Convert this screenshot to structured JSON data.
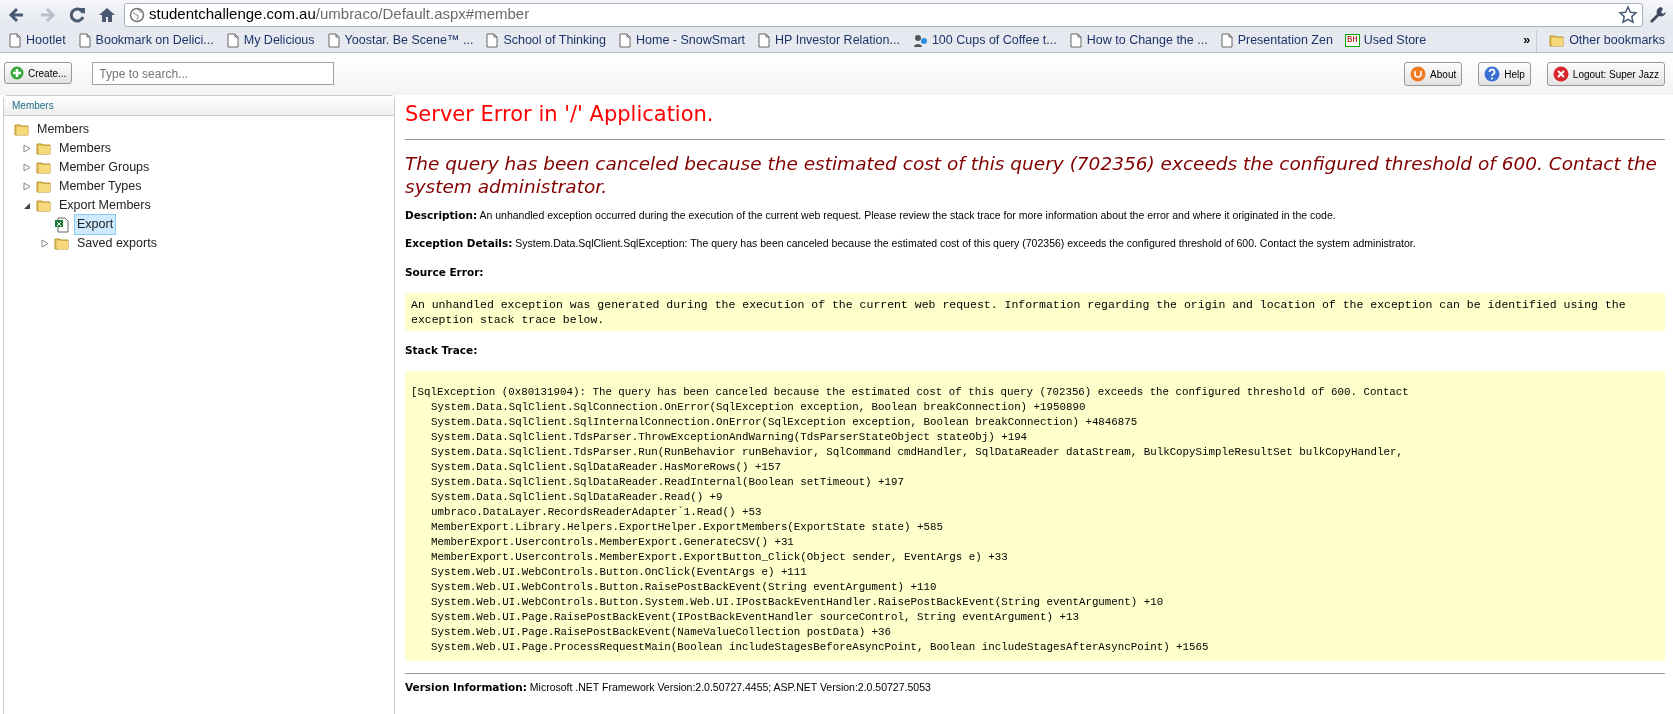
{
  "browser": {
    "nav": [
      {
        "kind": "back",
        "disabled": false
      },
      {
        "kind": "forward",
        "disabled": true
      },
      {
        "kind": "reload",
        "disabled": false
      },
      {
        "kind": "home",
        "disabled": false
      }
    ],
    "address": {
      "host": "studentchallenge.com.au",
      "path": "/umbraco/Default.aspx#member"
    },
    "bookmarks": [
      {
        "label": "Hootlet",
        "kind": "page"
      },
      {
        "label": "Bookmark on Delici...",
        "kind": "page"
      },
      {
        "label": "My Delicious",
        "kind": "page"
      },
      {
        "label": "Yoostar. Be Scene™ ...",
        "kind": "page"
      },
      {
        "label": "School of Thinking",
        "kind": "page"
      },
      {
        "label": "Home - SnowSmart",
        "kind": "page"
      },
      {
        "label": "HP Investor Relation...",
        "kind": "page"
      },
      {
        "label": "100 Cups of Coffee t...",
        "kind": "figure"
      },
      {
        "label": "How to Change the ...",
        "kind": "page"
      },
      {
        "label": "Presentation Zen",
        "kind": "page"
      },
      {
        "label": "Used Store",
        "kind": "letters",
        "icon_text": "BH"
      }
    ],
    "overflow": "»",
    "other_bookmarks": "Other bookmarks"
  },
  "toolbar": {
    "create": "Create...",
    "search": {
      "placeholder": "Type to search..."
    },
    "buttons": [
      {
        "kind": "about",
        "label": "About"
      },
      {
        "kind": "help",
        "label": "Help"
      },
      {
        "kind": "logout",
        "label": "Logout: Super Jazz"
      }
    ]
  },
  "tree": {
    "header": "Members",
    "root": {
      "label": "Members",
      "kind": "folder",
      "selected": false,
      "children": [
        {
          "label": "Members",
          "kind": "folder",
          "expanded": false,
          "selected": false
        },
        {
          "label": "Member Groups",
          "kind": "folder",
          "expanded": false,
          "selected": false
        },
        {
          "label": "Member Types",
          "kind": "folder",
          "expanded": false,
          "selected": false
        },
        {
          "label": "Export Members",
          "kind": "folder",
          "expanded": true,
          "selected": false,
          "children": [
            {
              "label": "Export",
              "kind": "spreadsheet",
              "selected": true
            },
            {
              "label": "Saved exports",
              "kind": "folder",
              "expanded": false,
              "selected": false
            }
          ]
        }
      ]
    }
  },
  "error": {
    "title": "Server Error in '/' Application.",
    "message": "The query has been canceled because the estimated cost of this query (702356) exceeds the configured threshold of 600. Contact the system administrator.",
    "description": {
      "label": "Description:",
      "text": "An unhandled exception occurred during the execution of the current web request. Please review the stack trace for more information about the error and where it originated in the code."
    },
    "exception_details": {
      "label": "Exception Details:",
      "text": "System.Data.SqlClient.SqlException: The query has been canceled because the estimated cost of this query (702356) exceeds the configured threshold of 600. Contact the system administrator."
    },
    "source_error": {
      "label": "Source Error:",
      "text": "An unhandled exception was generated during the execution of the current web request. Information regarding the origin and location of the exception can be identified using the exception stack trace below."
    },
    "stack_trace": {
      "label": "Stack Trace:",
      "exception": "[SqlException (0x80131904): The query has been canceled because the estimated cost of this query (702356) exceeds the configured threshold of 600. Contact",
      "frames": [
        "System.Data.SqlClient.SqlConnection.OnError(SqlException exception, Boolean breakConnection) +1950890",
        "System.Data.SqlClient.SqlInternalConnection.OnError(SqlException exception, Boolean breakConnection) +4846875",
        "System.Data.SqlClient.TdsParser.ThrowExceptionAndWarning(TdsParserStateObject stateObj) +194",
        "System.Data.SqlClient.TdsParser.Run(RunBehavior runBehavior, SqlCommand cmdHandler, SqlDataReader dataStream, BulkCopySimpleResultSet bulkCopyHandler,",
        "System.Data.SqlClient.SqlDataReader.HasMoreRows() +157",
        "System.Data.SqlClient.SqlDataReader.ReadInternal(Boolean setTimeout) +197",
        "System.Data.SqlClient.SqlDataReader.Read() +9",
        "umbraco.DataLayer.RecordsReaderAdapter`1.Read() +53",
        "MemberExport.Library.Helpers.ExportHelper.ExportMembers(ExportState state) +585",
        "MemberExport.Usercontrols.MemberExport.GenerateCSV() +31",
        "MemberExport.Usercontrols.MemberExport.ExportButton_Click(Object sender, EventArgs e) +33",
        "System.Web.UI.WebControls.Button.OnClick(EventArgs e) +111",
        "System.Web.UI.WebControls.Button.RaisePostBackEvent(String eventArgument) +110",
        "System.Web.UI.WebControls.Button.System.Web.UI.IPostBackEventHandler.RaisePostBackEvent(String eventArgument) +10",
        "System.Web.UI.Page.RaisePostBackEvent(IPostBackEventHandler sourceControl, String eventArgument) +13",
        "System.Web.UI.Page.RaisePostBackEvent(NameValueCollection postData) +36",
        "System.Web.UI.Page.ProcessRequestMain(Boolean includeStagesBeforeAsyncPoint, Boolean includeStagesAfterAsyncPoint) +1565"
      ]
    },
    "version": {
      "label": "Version Information:",
      "text": "Microsoft .NET Framework Version:2.0.50727.4455; ASP.NET Version:2.0.50727.5053"
    }
  }
}
